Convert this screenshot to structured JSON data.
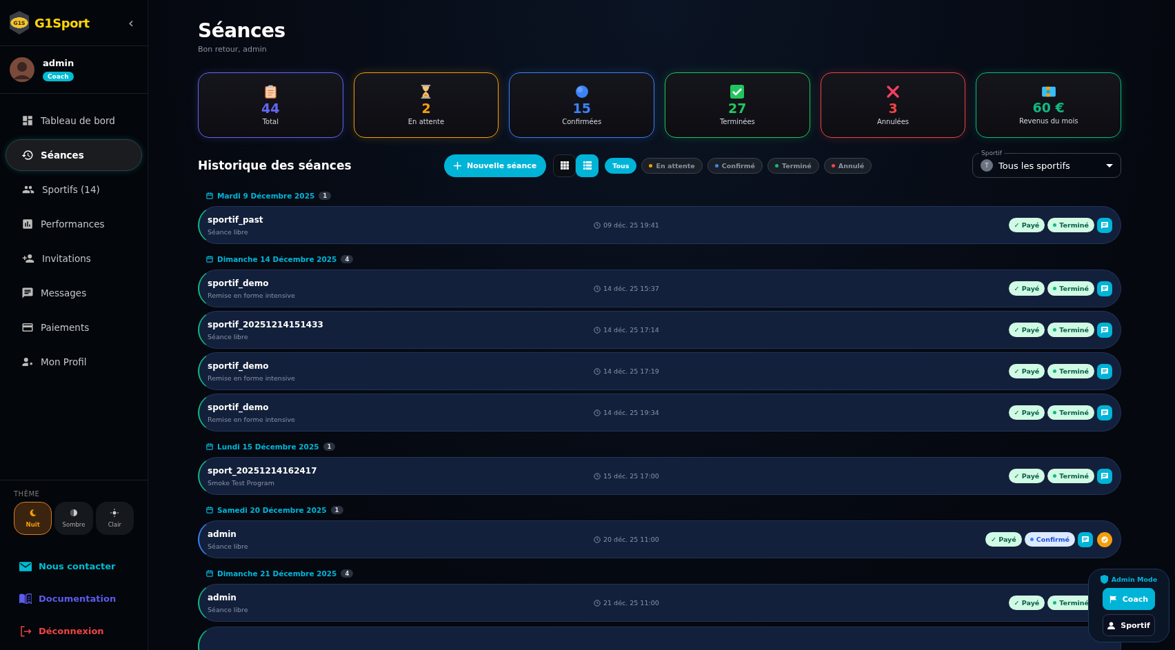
{
  "sidebar": {
    "brand": "G1Sport",
    "logo_text": "G1S",
    "collapse": "‹",
    "user": {
      "name": "admin",
      "role": "Coach"
    },
    "nav": [
      {
        "label": "Tableau de bord",
        "selected": false
      },
      {
        "label": "Séances",
        "selected": true
      },
      {
        "label": "Sportifs (14)",
        "selected": false
      },
      {
        "label": "Performances",
        "selected": false
      },
      {
        "label": "Invitations",
        "selected": false
      },
      {
        "label": "Messages",
        "selected": false
      },
      {
        "label": "Paiements",
        "selected": false
      },
      {
        "label": "Mon Profil",
        "selected": false
      }
    ],
    "theme": {
      "title": "THÈME",
      "options": [
        {
          "label": "Nuit",
          "selected": true
        },
        {
          "label": "Sombre",
          "selected": false
        },
        {
          "label": "Clair",
          "selected": false
        }
      ]
    },
    "links": [
      {
        "label": "Nous contacter",
        "color": "#00bcd4"
      },
      {
        "label": "Documentation",
        "color": "#5b5bf0"
      },
      {
        "label": "Déconnexion",
        "color": "#ef4444"
      }
    ]
  },
  "page": {
    "title": "Séances",
    "subtitle": "Bon retour, admin"
  },
  "stats": [
    {
      "value": "44",
      "label": "Total",
      "color": "#6366f1"
    },
    {
      "value": "2",
      "label": "En attente",
      "color": "#f59e0b"
    },
    {
      "value": "15",
      "label": "Confirmées",
      "color": "#3b82f6"
    },
    {
      "value": "27",
      "label": "Terminées",
      "color": "#22c55e"
    },
    {
      "value": "3",
      "label": "Annulées",
      "color": "#ef4444"
    },
    {
      "value": "60 €",
      "label": "Revenus du mois",
      "color": "#10b981"
    }
  ],
  "toolbar": {
    "title": "Historique des séances",
    "new_button": "Nouvelle séance",
    "views": [
      {
        "kind": "grid",
        "selected": false
      },
      {
        "kind": "list",
        "selected": true
      }
    ],
    "filters": [
      {
        "label": "Tous",
        "selected": true
      },
      {
        "label": "En attente",
        "selected": false,
        "color": "#f59e0b"
      },
      {
        "label": "Confirmé",
        "selected": false,
        "color": "#3b82f6"
      },
      {
        "label": "Terminé",
        "selected": false,
        "color": "#10b981"
      },
      {
        "label": "Annulé",
        "selected": false,
        "color": "#ef4444"
      }
    ],
    "athlete_select": {
      "label": "Sportif",
      "avatar": "T",
      "value": "Tous les sportifs"
    }
  },
  "groups": [
    {
      "date": "Mardi 9 Décembre 2025",
      "count": "1",
      "sessions": [
        {
          "name": "sportif_past",
          "program": "Séance libre",
          "time": "09 déc. 25 19:41",
          "payment": "✓ Payé",
          "status": "Terminé",
          "kind": "done",
          "confirm": false,
          "chat": true
        }
      ]
    },
    {
      "date": "Dimanche 14 Décembre 2025",
      "count": "4",
      "sessions": [
        {
          "name": "sportif_demo",
          "program": "Remise en forme intensive",
          "time": "14 déc. 25 15:37",
          "payment": "✓ Payé",
          "status": "Terminé",
          "kind": "done",
          "confirm": false,
          "chat": true
        },
        {
          "name": "sportif_20251214151433",
          "program": "Séance libre",
          "time": "14 déc. 25 17:14",
          "payment": "✓ Payé",
          "status": "Terminé",
          "kind": "done",
          "confirm": false,
          "chat": true
        },
        {
          "name": "sportif_demo",
          "program": "Remise en forme intensive",
          "time": "14 déc. 25 17:19",
          "payment": "✓ Payé",
          "status": "Terminé",
          "kind": "done",
          "confirm": false,
          "chat": true
        },
        {
          "name": "sportif_demo",
          "program": "Remise en forme intensive",
          "time": "14 déc. 25 19:34",
          "payment": "✓ Payé",
          "status": "Terminé",
          "kind": "done",
          "confirm": false,
          "chat": true
        }
      ]
    },
    {
      "date": "Lundi 15 Décembre 2025",
      "count": "1",
      "sessions": [
        {
          "name": "sport_20251214162417",
          "program": "Smoke Test Program",
          "time": "15 déc. 25 17:00",
          "payment": "✓ Payé",
          "status": "Terminé",
          "kind": "done",
          "confirm": false,
          "chat": true
        }
      ]
    },
    {
      "date": "Samedi 20 Décembre 2025",
      "count": "1",
      "sessions": [
        {
          "name": "admin",
          "program": "Séance libre",
          "time": "20 déc. 25 11:00",
          "payment": "✓ Payé",
          "status": "Confirmé",
          "kind": "confirmed",
          "confirm": true,
          "chat": true
        }
      ]
    },
    {
      "date": "Dimanche 21 Décembre 2025",
      "count": "4",
      "sessions": [
        {
          "name": "admin",
          "program": "Séance libre",
          "time": "21 déc. 25 11:00",
          "payment": "✓ Payé",
          "status": "Terminé",
          "kind": "done",
          "confirm": false,
          "chat": false
        }
      ],
      "more_below": true
    }
  ],
  "admin_mode": {
    "title": "Admin Mode",
    "options": [
      {
        "label": "Coach",
        "selected": true
      },
      {
        "label": "Sportif",
        "selected": false
      }
    ]
  }
}
